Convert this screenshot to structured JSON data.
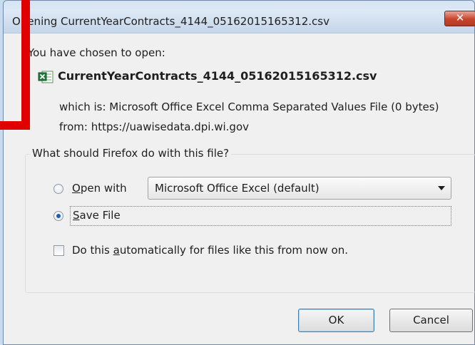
{
  "dialog": {
    "title": "Opening CurrentYearContracts_4144_05162015165312.csv",
    "close_glyph": "✕",
    "intro": "You have chosen to open:",
    "file_name": "CurrentYearContracts_4144_05162015165312.csv",
    "file_icon": "excel-csv-icon",
    "which_is_label": "which is:",
    "which_is_value": "Microsoft Office Excel Comma Separated Values File (0 bytes)",
    "from_label": "from:",
    "from_value": "https://uawisedata.dpi.wi.gov"
  },
  "action_group": {
    "legend": "What should Firefox do with this file?",
    "open_with": {
      "label_key": "O",
      "label_rest": "pen with",
      "selected": false
    },
    "application_select": {
      "value": "Microsoft Office Excel (default)"
    },
    "save_file": {
      "label_key": "S",
      "label_rest": "ave File",
      "selected": true
    },
    "auto_checkbox": {
      "label_pre": "Do this ",
      "label_key": "a",
      "label_post": "utomatically for files like this from now on.",
      "checked": false
    }
  },
  "buttons": {
    "ok": "OK",
    "cancel": "Cancel"
  },
  "colors": {
    "highlight": "#e00000",
    "radio_selected": "#1d5fb0"
  }
}
